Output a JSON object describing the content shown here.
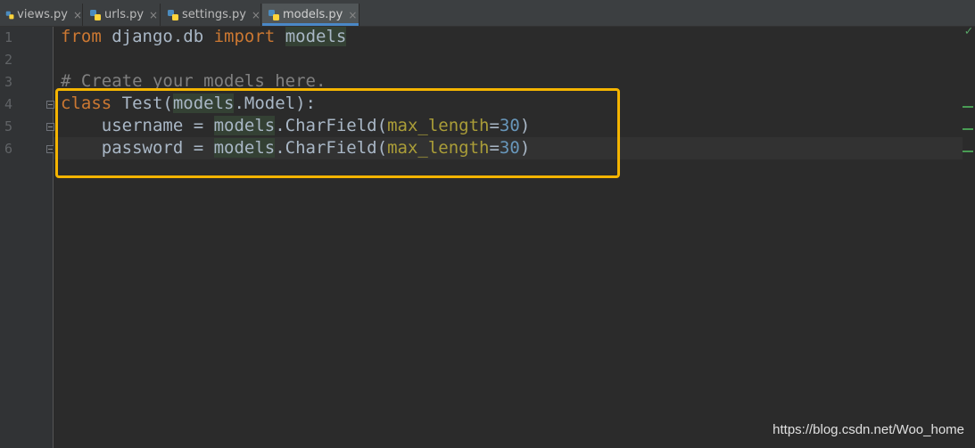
{
  "tabs": [
    {
      "label": "views.py",
      "active": false
    },
    {
      "label": "urls.py",
      "active": false
    },
    {
      "label": "settings.py",
      "active": false
    },
    {
      "label": "models.py",
      "active": true
    }
  ],
  "close_glyph": "×",
  "line_numbers": [
    "1",
    "2",
    "3",
    "4",
    "5",
    "6"
  ],
  "code": {
    "l1": {
      "kw_from": "from",
      "mod": " django.db ",
      "kw_import": "import",
      "sp": " ",
      "ref": "models"
    },
    "l3": {
      "comment": "# Create your models here."
    },
    "l4": {
      "kw_class": "class",
      "name": " Test(",
      "ref": "models",
      "rest": ".Model):"
    },
    "l5": {
      "indent": "    username = ",
      "ref": "models",
      "call": ".CharField(",
      "param": "max_length",
      "eq": "=",
      "num": "30",
      "close": ")"
    },
    "l6": {
      "indent": "    password = ",
      "ref": "models",
      "call": ".CharField(",
      "param": "max_length",
      "eq": "=",
      "num": "30",
      "close": ")"
    }
  },
  "status_check": "✓",
  "watermark": "https://blog.csdn.net/Woo_home",
  "colors": {
    "keyword": "#cc7832",
    "comment": "#808080",
    "number": "#6897bb",
    "parameter": "#aa9d38",
    "annotation_box": "#f4b400",
    "active_tab_underline": "#4a88c7"
  }
}
